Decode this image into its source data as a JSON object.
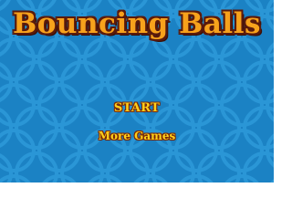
{
  "game": {
    "title": "Bouncing Balls",
    "background_color": "#1b82c4",
    "pattern_color": "#2a96d6",
    "title_color": "#f7a21c",
    "menu_color": "#ffd11a"
  },
  "menu": {
    "start_label": "START",
    "more_games_label": "More Games"
  }
}
